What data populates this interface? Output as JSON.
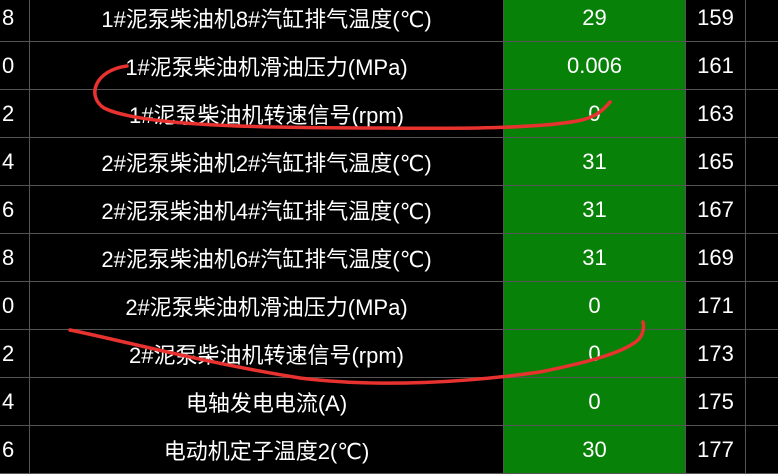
{
  "table": {
    "rows": [
      {
        "idx": "8",
        "name": "1#泥泵柴油机8#汽缸排气温度(℃)",
        "value": "29",
        "addr": "159"
      },
      {
        "idx": "0",
        "name": "1#泥泵柴油机滑油压力(MPa)",
        "value": "0.006",
        "addr": "161"
      },
      {
        "idx": "2",
        "name": "1#泥泵柴油机转速信号(rpm)",
        "value": "0",
        "addr": "163"
      },
      {
        "idx": "4",
        "name": "2#泥泵柴油机2#汽缸排气温度(℃)",
        "value": "31",
        "addr": "165"
      },
      {
        "idx": "6",
        "name": "2#泥泵柴油机4#汽缸排气温度(℃)",
        "value": "31",
        "addr": "167"
      },
      {
        "idx": "8",
        "name": "2#泥泵柴油机6#汽缸排气温度(℃)",
        "value": "31",
        "addr": "169"
      },
      {
        "idx": "0",
        "name": "2#泥泵柴油机滑油压力(MPa)",
        "value": "0",
        "addr": "171"
      },
      {
        "idx": "2",
        "name": "2#泥泵柴油机转速信号(rpm)",
        "value": "0",
        "addr": "173"
      },
      {
        "idx": "4",
        "name": "电轴发电电流(A)",
        "value": "0",
        "addr": "175"
      },
      {
        "idx": "6",
        "name": "电动机定子温度2(℃)",
        "value": "30",
        "addr": "177"
      }
    ]
  },
  "colors": {
    "value_bg": "#078107",
    "annotation": "#e8322f"
  }
}
